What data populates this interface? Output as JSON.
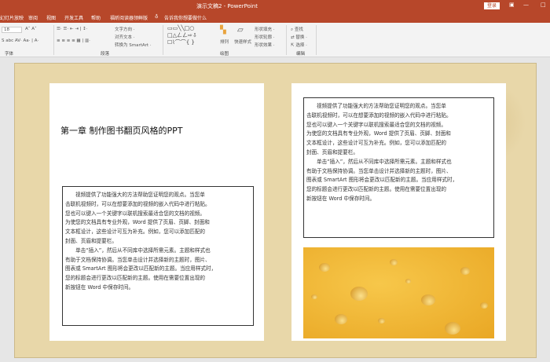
{
  "titlebar": {
    "title": "演示文稿2 - PowerPoint",
    "login": "登录"
  },
  "tabs": [
    "幻灯片放映",
    "审阅",
    "视图",
    "开发工具",
    "帮助",
    "福昕阅读器领鲜版",
    "告诉我你想要做什么"
  ],
  "ribbon": {
    "font_size": "18",
    "text_direction": "文字方向 ·",
    "align_text": "对齐文本 ·",
    "convert_smartart": "转换为 SmartArt ·",
    "arrange": "排列",
    "quick_styles": "快速样式",
    "shape_fill": "形状填充 ·",
    "shape_outline": "形状轮廓 ·",
    "shape_effects": "形状效果 ·",
    "find": "查找",
    "replace": "替换 ·",
    "select": "选择 ·",
    "groups": {
      "font": "字体",
      "paragraph": "段落",
      "drawing": "绘图",
      "editing": "编辑"
    }
  },
  "slide": {
    "title": "第一章 制作图书翻页风格的PPT",
    "lines": [
      "视频提供了功能强大的方法帮助您证明您的观点。当您单",
      "击联机视频时，可以在想要添加的视频的嵌入代码中进行粘贴。",
      "您也可以键入一个关键字以联机搜索最适合您的文档的视频。",
      "为使您的文档具有专业外观，Word 提供了页眉、页脚、封面和",
      "文本框设计，这些设计可互为补充。例如，您可以添加匹配的",
      "封面、页眉和提要栏。",
      "单击“插入”，然后从不同库中选择所需元素。主题和样式也",
      "有助于文档保持协调。当您单击设计并选择新的主题时，图片、",
      "图表或 SmartArt 图形将会更改以匹配新的主题。当应用样式时，",
      "您的标题会进行更改以匹配新的主题。使用在需要位置出现的",
      "新按钮在 Word 中保存时间。"
    ]
  }
}
